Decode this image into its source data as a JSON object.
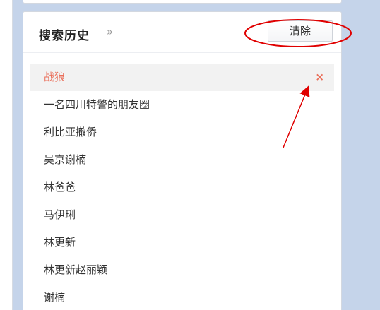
{
  "panel": {
    "title": "搜索历史",
    "title_arrow": "»",
    "clear_label": "清除"
  },
  "history": {
    "items": [
      {
        "label": "战狼",
        "active": true
      },
      {
        "label": "一名四川特警的朋友圈"
      },
      {
        "label": "利比亚撤侨"
      },
      {
        "label": "吴京谢楠"
      },
      {
        "label": "林爸爸"
      },
      {
        "label": "马伊琍"
      },
      {
        "label": "林更新"
      },
      {
        "label": "林更新赵丽颖"
      },
      {
        "label": "谢楠"
      }
    ],
    "delete_glyph": "×"
  },
  "icons": {
    "delete": "close-icon",
    "more": "double-chevron-right-icon"
  },
  "colors": {
    "page_background": "#c5d4ea",
    "active_text": "#ea6f5a",
    "annotation": "#e00000"
  }
}
